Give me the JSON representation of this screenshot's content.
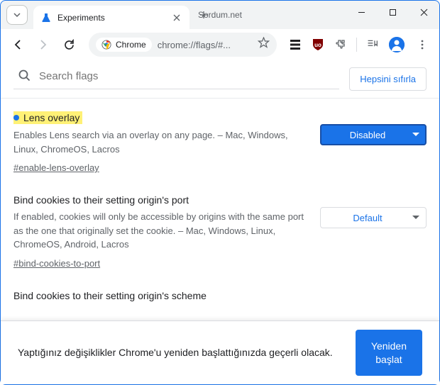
{
  "titlebar": {
    "tab_title": "Experiments",
    "site_name": "Sordum.net"
  },
  "toolbar": {
    "addr_chip": "Chrome",
    "addr_url": "chrome://flags/#..."
  },
  "search": {
    "placeholder": "Search flags",
    "reset_label": "Hepsini sıfırla"
  },
  "flags": [
    {
      "title": "Lens overlay",
      "highlighted": true,
      "desc": "Enables Lens search via an overlay on any page. – Mac, Windows, Linux, ChromeOS, Lacros",
      "hash": "#enable-lens-overlay",
      "selected": "Disabled",
      "style": "blue"
    },
    {
      "title": "Bind cookies to their setting origin's port",
      "highlighted": false,
      "desc": "If enabled, cookies will only be accessible by origins with the same port as the one that originally set the cookie. – Mac, Windows, Linux, ChromeOS, Android, Lacros",
      "hash": "#bind-cookies-to-port",
      "selected": "Default",
      "style": "white"
    },
    {
      "title": "Bind cookies to their setting origin's scheme",
      "highlighted": false,
      "desc": "",
      "hash": "",
      "selected": "",
      "style": ""
    }
  ],
  "restart": {
    "text": "Yaptığınız değişiklikler Chrome'u yeniden başlattığınızda geçerli olacak.",
    "button": "Yeniden başlat"
  }
}
